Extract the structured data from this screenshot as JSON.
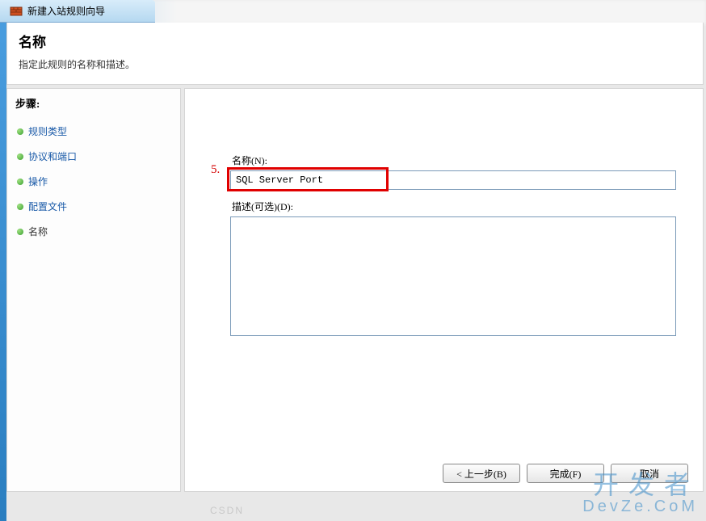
{
  "window": {
    "title": "新建入站规则向导"
  },
  "header": {
    "title": "名称",
    "subtitle": "指定此规则的名称和描述。"
  },
  "sidebar": {
    "steps_header": "步骤:",
    "items": [
      {
        "label": "规则类型"
      },
      {
        "label": "协议和端口"
      },
      {
        "label": "操作"
      },
      {
        "label": "配置文件"
      },
      {
        "label": "名称"
      }
    ],
    "current_index": 4
  },
  "main": {
    "annotation_number": "5.",
    "name_label": "名称(N):",
    "name_value": "SQL Server Port",
    "desc_label": "描述(可选)(D):",
    "desc_value": ""
  },
  "buttons": {
    "back": "< 上一步(B)",
    "finish": "完成(F)",
    "cancel": "取消"
  },
  "watermark": {
    "top": "开发者",
    "sub": "DevZe.CoM",
    "faded": "CSDN"
  }
}
